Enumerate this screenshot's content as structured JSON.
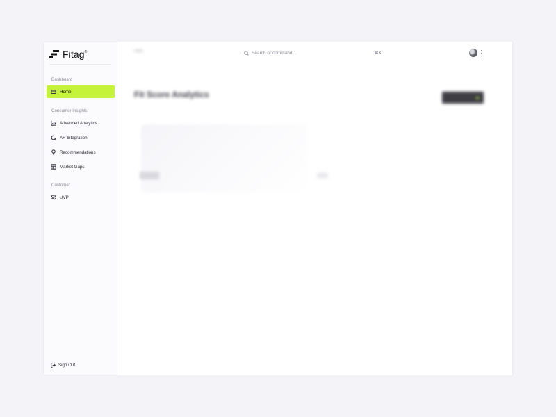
{
  "brand": {
    "name": "Fitag",
    "mark": "®"
  },
  "sidebar": {
    "sections": [
      {
        "label": "Dashboard",
        "items": [
          {
            "label": "Home",
            "icon": "home-icon",
            "active": true
          }
        ]
      },
      {
        "label": "Consumer Insights",
        "items": [
          {
            "label": "Advanced Analytics",
            "icon": "bar-chart-icon"
          },
          {
            "label": "AR Integration",
            "icon": "ar-icon"
          },
          {
            "label": "Recommendations",
            "icon": "lightbulb-icon"
          },
          {
            "label": "Market Gaps",
            "icon": "grid-icon"
          }
        ]
      },
      {
        "label": "Customer",
        "items": [
          {
            "label": "UVP",
            "icon": "users-icon"
          }
        ]
      }
    ],
    "signout": "Sign Out"
  },
  "header": {
    "breadcrumb": "Hom",
    "search_placeholder": "Search or command...",
    "search_shortcut": "⌘K"
  },
  "main": {
    "title": "Fit Score Analytics"
  },
  "colors": {
    "accent": "#c5f33a",
    "background": "#f4f3f7"
  }
}
